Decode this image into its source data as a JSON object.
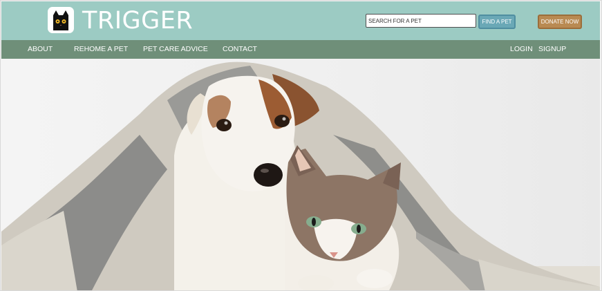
{
  "brand": {
    "name": "TRIGGER",
    "logo_icon": "black-cat-icon"
  },
  "search": {
    "placeholder": "SEARCH FOR A PET",
    "button_label": "FIND A PET"
  },
  "donate": {
    "label": "DONATE NOW"
  },
  "nav": {
    "left": [
      "ABOUT",
      "REHOME A PET",
      "PET CARE ADVICE",
      "CONTACT"
    ],
    "right": [
      "LOGIN",
      "SIGNUP"
    ]
  },
  "hero": {
    "image": "dog-and-cat-under-blanket"
  },
  "colors": {
    "header": "#9ccbc3",
    "nav": "#6f8f79",
    "find_button": "#6aa8b6",
    "donate_button": "#b98a52"
  }
}
